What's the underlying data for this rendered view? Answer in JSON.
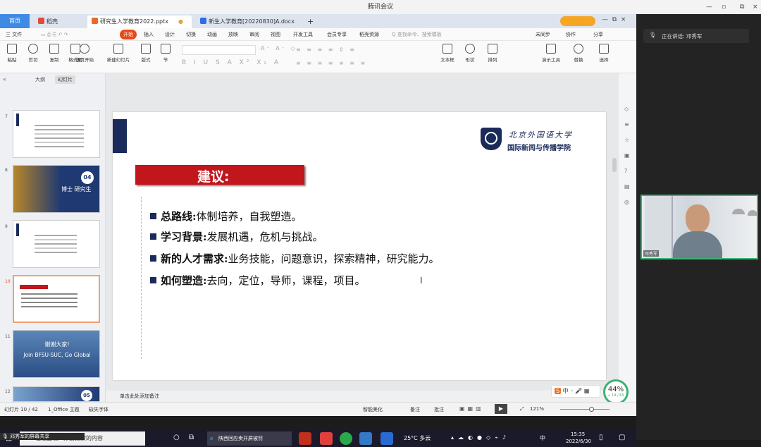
{
  "window_title": "腾讯会议",
  "tabs": [
    "首页",
    "稻壳",
    "研究生入学教育2022.pptx",
    "新生入学教育[20220830]A.docx"
  ],
  "menu": {
    "file": "三 文件",
    "items": [
      "开始",
      "插入",
      "设计",
      "切换",
      "动画",
      "放映",
      "审阅",
      "视图",
      "开发工具",
      "会员专享",
      "稻壳资源"
    ],
    "search": "Q 查找命令、搜索模板",
    "right": [
      "未同步",
      "协作",
      "分享"
    ]
  },
  "ribbon": [
    {
      "label": "粘贴"
    },
    {
      "label": "剪切"
    },
    {
      "label": "复制"
    },
    {
      "label": "格式刷"
    },
    {
      "label": "当页开始"
    },
    {
      "label": "新建幻灯片"
    },
    {
      "label": "版式"
    },
    {
      "label": "节"
    },
    {
      "label": "文本框"
    },
    {
      "label": "形状"
    },
    {
      "label": "排列"
    },
    {
      "label": "演示工具"
    },
    {
      "label": "替换"
    },
    {
      "label": "选择"
    }
  ],
  "leftpane": {
    "tabs": [
      "大纲",
      "幻灯片"
    ],
    "slides": [
      {
        "num": "7"
      },
      {
        "num": "8",
        "title": "博士 研究生",
        "badge": "04"
      },
      {
        "num": "9"
      },
      {
        "num": "10"
      },
      {
        "num": "11",
        "title": "谢谢大家!",
        "subtitle": "Join BFSU-SUC, Go Global"
      },
      {
        "num": "12",
        "badge": "05"
      }
    ]
  },
  "slide": {
    "logo_main": "北京外国语大学",
    "logo_sub": "国际新闻与传播学院",
    "heading": "建议:",
    "bullets": [
      {
        "key": "总路线:",
        "text": "体制培养，自我塑造。"
      },
      {
        "key": "学习背景:",
        "text": "发展机遇，危机与挑战。"
      },
      {
        "key": "新的人才需求:",
        "text": "业务技能，问题意识，探索精神，研究能力。"
      },
      {
        "key": "如何塑造:",
        "text": "去向，定位，导师，课程，项目。"
      }
    ]
  },
  "notes": "单击此处添加备注",
  "status": {
    "slide": "幻灯片 10 / 42",
    "theme": "1_Office 主题",
    "font": "缺失字体",
    "beautify": "智能美化",
    "notes": "备注",
    "comment": "批注",
    "zoom": "121%",
    "progress": "44%",
    "progress_sub": "+ 14 / KS"
  },
  "taskbar": {
    "search": "在这里输入你要搜索的内容",
    "task": "陕西回应卖开屏被罚",
    "weather": "25°C 多云",
    "ime": "中",
    "time": "15:35",
    "date": "2022/6/30"
  },
  "caption": "邓秀军的屏幕共享",
  "panel": {
    "speaking": "正在讲话: 邓秀军",
    "participant": "邓秀军"
  }
}
